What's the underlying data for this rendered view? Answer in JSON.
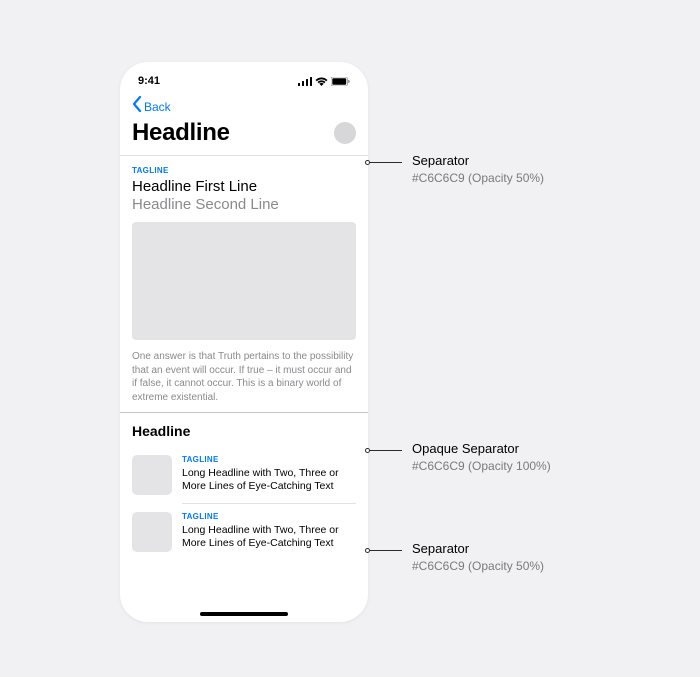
{
  "status": {
    "time": "9:41"
  },
  "nav": {
    "back": "Back"
  },
  "header": {
    "title": "Headline"
  },
  "article": {
    "tagline": "TAGLINE",
    "line1": "Headline First Line",
    "line2": "Headline Second Line",
    "body": "One answer is that Truth pertains to the possibility that an event will occur. If true – it must occur and if false, it cannot occur. This is a binary world of extreme existential."
  },
  "section": {
    "headline": "Headline"
  },
  "list": {
    "item1": {
      "tagline": "TAGLINE",
      "headline": "Long Headline with Two, Three or More Lines of Eye-Catching Text"
    },
    "item2": {
      "tagline": "TAGLINE",
      "headline": "Long Headline with Two, Three or More Lines of Eye-Catching Text"
    }
  },
  "annotations": {
    "a1": {
      "title": "Separator",
      "sub": "#C6C6C9 (Opacity 50%)"
    },
    "a2": {
      "title": "Opaque Separator",
      "sub": "#C6C6C9 (Opacity 100%)"
    },
    "a3": {
      "title": "Separator",
      "sub": "#C6C6C9 (Opacity 50%)"
    }
  },
  "colors": {
    "separator": "#C6C6C9",
    "link": "#007AFF"
  }
}
